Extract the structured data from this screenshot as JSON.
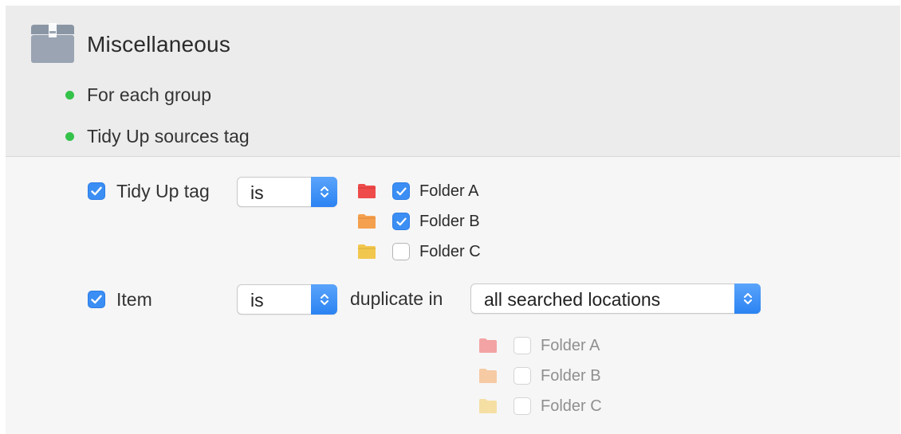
{
  "section": {
    "title": "Miscellaneous",
    "icon": "box-icon",
    "bullets": [
      {
        "label": "For each group",
        "color": "#35c24a"
      },
      {
        "label": "Tidy Up sources tag",
        "color": "#35c24a"
      }
    ]
  },
  "rows": {
    "tag": {
      "checked": true,
      "label": "Tidy Up tag",
      "operator": "is",
      "folders": [
        {
          "label": "Folder A",
          "checked": true,
          "color": "#ef4b4b"
        },
        {
          "label": "Folder B",
          "checked": true,
          "color": "#f5a04e"
        },
        {
          "label": "Folder C",
          "checked": false,
          "color": "#f2c74e"
        }
      ]
    },
    "item": {
      "checked": true,
      "label": "Item",
      "operator": "is",
      "connector": "duplicate in",
      "location": "all searched locations",
      "folders": [
        {
          "label": "Folder A",
          "checked": false,
          "color": "#f3a3a3"
        },
        {
          "label": "Folder B",
          "checked": false,
          "color": "#f6caa3"
        },
        {
          "label": "Folder C",
          "checked": false,
          "color": "#f5dfa3"
        }
      ]
    }
  },
  "colors": {
    "accent": "#3b8ef3",
    "status_green": "#35c24a"
  }
}
